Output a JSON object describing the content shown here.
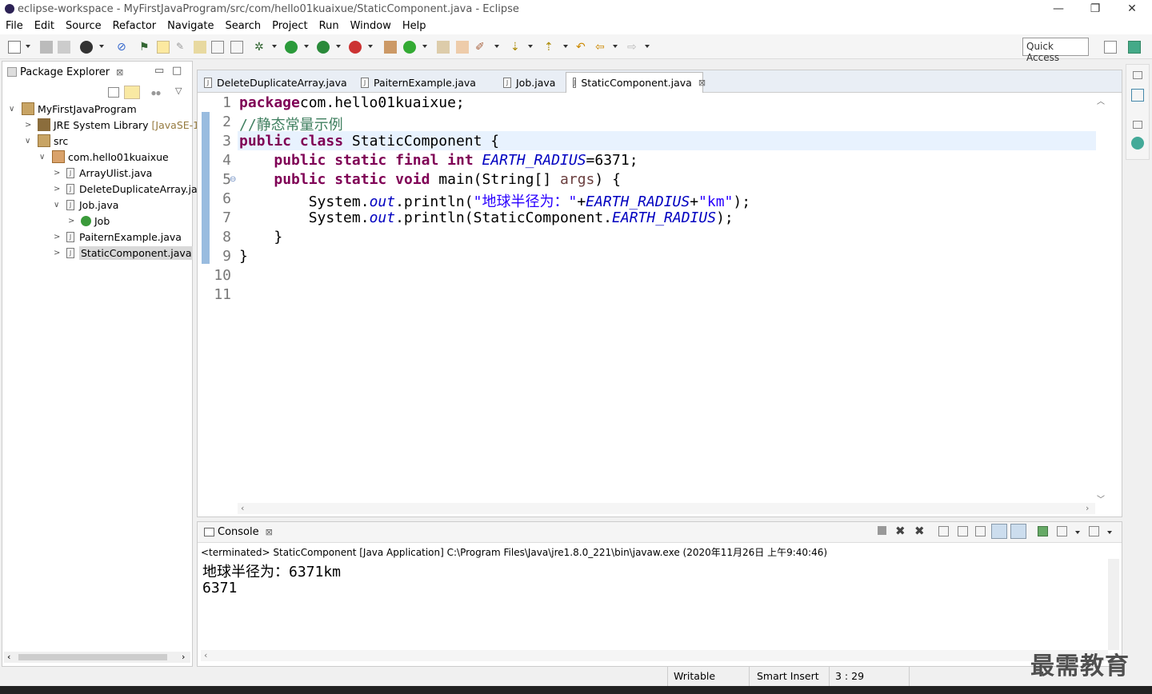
{
  "window": {
    "title": "eclipse-workspace - MyFirstJavaProgram/src/com/hello01kuaixue/StaticComponent.java - Eclipse"
  },
  "menu": [
    "File",
    "Edit",
    "Source",
    "Refactor",
    "Navigate",
    "Search",
    "Project",
    "Run",
    "Window",
    "Help"
  ],
  "toolbar": {
    "quick_access": "Quick Access"
  },
  "package_explorer": {
    "title": "Package Explorer",
    "tree": [
      {
        "label": "MyFirstJavaProgram",
        "depth": 0,
        "twisty": "∨"
      },
      {
        "label": "JRE System Library",
        "suffix": "[JavaSE-1.",
        "depth": 1,
        "twisty": ">"
      },
      {
        "label": "src",
        "depth": 1,
        "twisty": "∨"
      },
      {
        "label": "com.hello01kuaixue",
        "depth": 2,
        "twisty": "∨"
      },
      {
        "label": "ArrayUlist.java",
        "depth": 3,
        "twisty": ">"
      },
      {
        "label": "DeleteDuplicateArray.ja",
        "depth": 3,
        "twisty": ">"
      },
      {
        "label": "Job.java",
        "depth": 3,
        "twisty": "∨"
      },
      {
        "label": "Job",
        "depth": 4,
        "twisty": ">"
      },
      {
        "label": "PaiternExample.java",
        "depth": 3,
        "twisty": ">"
      },
      {
        "label": "StaticComponent.java",
        "depth": 3,
        "twisty": ">",
        "selected": true
      }
    ]
  },
  "editor": {
    "tabs": [
      "DeleteDuplicateArray.java",
      "PaiternExample.java",
      "Job.java",
      "StaticComponent.java"
    ],
    "active_tab": 3,
    "line_numbers": [
      "1",
      "2",
      "3",
      "4",
      "5",
      "6",
      "7",
      "8",
      "9",
      "10",
      "11"
    ]
  },
  "console": {
    "title": "Console",
    "terminated": "<terminated> StaticComponent [Java Application] C:\\Program Files\\Java\\jre1.8.0_221\\bin\\javaw.exe (2020年11月26日 上午9:40:46)",
    "output": [
      "地球半径为：6371km",
      "6371"
    ]
  },
  "status": {
    "writable": "Writable",
    "insert_mode": "Smart Insert",
    "position": "3 : 29"
  },
  "watermark": "最需教育",
  "colors": {
    "keyword": "#7f0055",
    "comment": "#3f7f5f",
    "string": "#2a00ff",
    "field": "#0000c0"
  }
}
